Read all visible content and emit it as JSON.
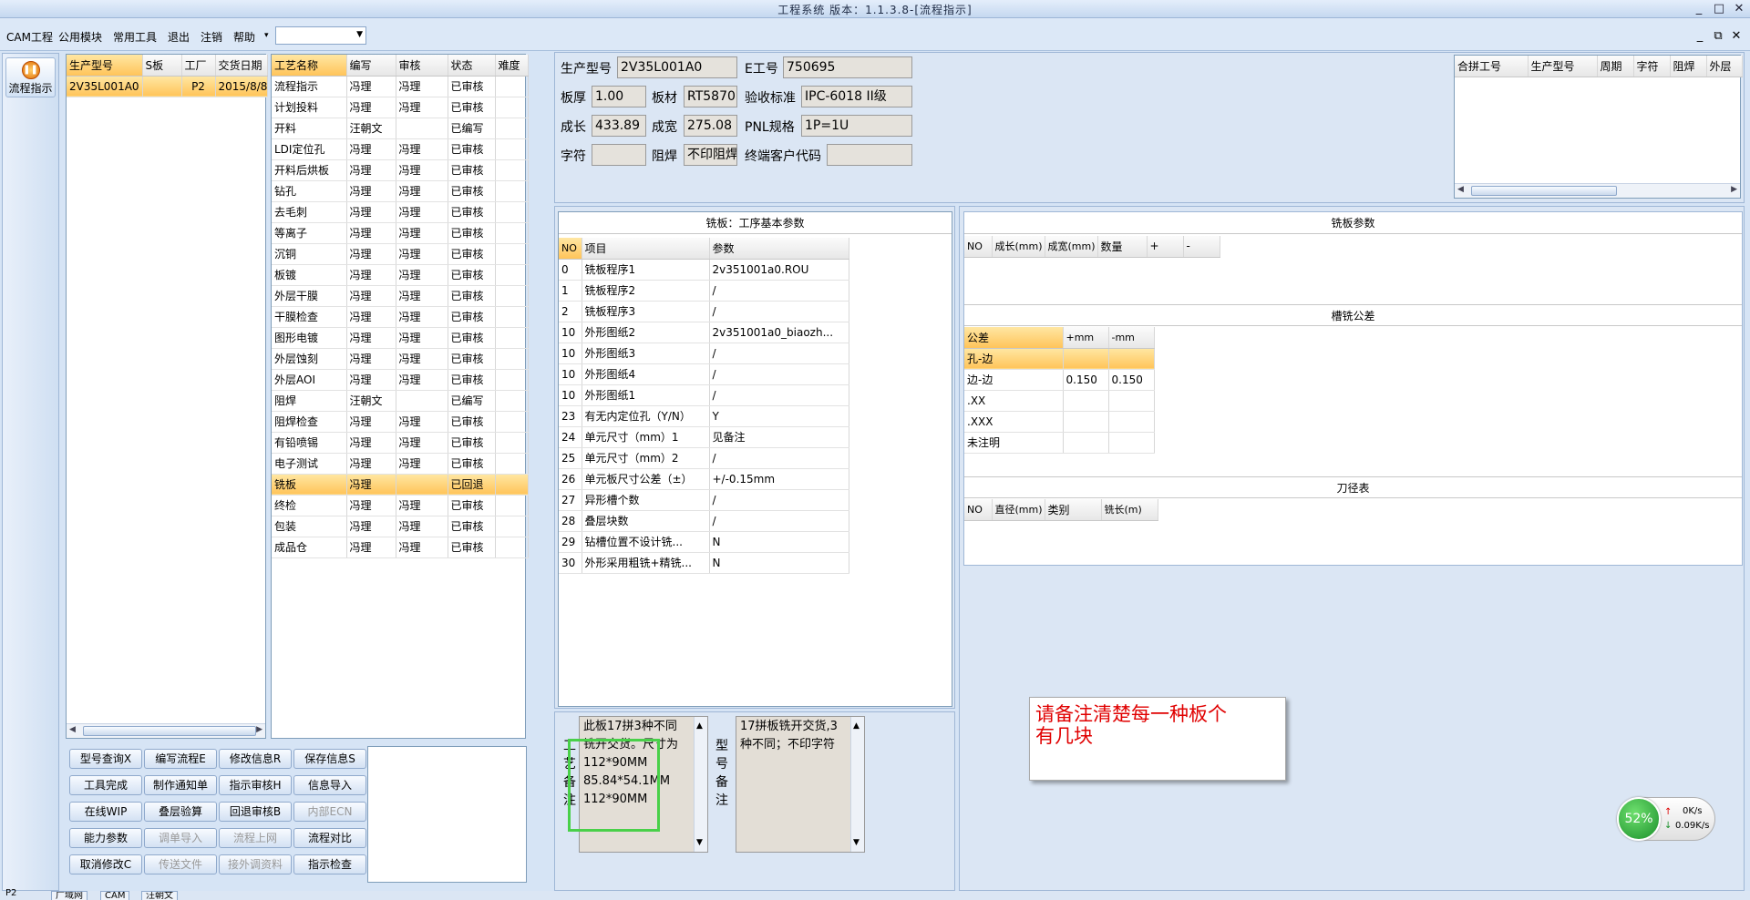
{
  "window": {
    "title": "工程系统 版本：1.1.3.8-[流程指示]",
    "controls": [
      "_",
      "□",
      "✕"
    ]
  },
  "menubar": {
    "items": [
      "CAM工程",
      "公用模块",
      "常用工具",
      "退出",
      "注销",
      "帮助"
    ],
    "mdi_controls": [
      "_",
      "⧉",
      "✕"
    ]
  },
  "leftnav": {
    "label": "流程指示"
  },
  "part_list": {
    "headers": [
      "生产型号",
      "S板",
      "工厂",
      "交货日期"
    ],
    "rows": [
      [
        "2V35L001A0",
        "",
        "P2",
        "2015/8/8"
      ]
    ]
  },
  "process_list": {
    "headers": [
      "工艺名称",
      "编写",
      "审核",
      "状态",
      "难度"
    ],
    "selected_index": 19,
    "rows": [
      [
        "流程指示",
        "冯理",
        "冯理",
        "已审核",
        ""
      ],
      [
        "计划投料",
        "冯理",
        "冯理",
        "已审核",
        ""
      ],
      [
        "开料",
        "汪朝文",
        "",
        "已编写",
        ""
      ],
      [
        "LDI定位孔",
        "冯理",
        "冯理",
        "已审核",
        ""
      ],
      [
        "开料后烘板",
        "冯理",
        "冯理",
        "已审核",
        ""
      ],
      [
        "钻孔",
        "冯理",
        "冯理",
        "已审核",
        ""
      ],
      [
        "去毛刺",
        "冯理",
        "冯理",
        "已审核",
        ""
      ],
      [
        "等离子",
        "冯理",
        "冯理",
        "已审核",
        ""
      ],
      [
        "沉铜",
        "冯理",
        "冯理",
        "已审核",
        ""
      ],
      [
        "板镀",
        "冯理",
        "冯理",
        "已审核",
        ""
      ],
      [
        "外层干膜",
        "冯理",
        "冯理",
        "已审核",
        ""
      ],
      [
        "干膜检查",
        "冯理",
        "冯理",
        "已审核",
        ""
      ],
      [
        "图形电镀",
        "冯理",
        "冯理",
        "已审核",
        ""
      ],
      [
        "外层蚀刻",
        "冯理",
        "冯理",
        "已审核",
        ""
      ],
      [
        "外层AOI",
        "冯理",
        "冯理",
        "已审核",
        ""
      ],
      [
        "阻焊",
        "汪朝文",
        "",
        "已编写",
        ""
      ],
      [
        "阻焊检查",
        "冯理",
        "冯理",
        "已审核",
        ""
      ],
      [
        "有铅喷锡",
        "冯理",
        "冯理",
        "已审核",
        ""
      ],
      [
        "电子测试",
        "冯理",
        "冯理",
        "已审核",
        ""
      ],
      [
        "铣板",
        "冯理",
        "",
        "已回退",
        ""
      ],
      [
        "终检",
        "冯理",
        "冯理",
        "已审核",
        ""
      ],
      [
        "包装",
        "冯理",
        "冯理",
        "已审核",
        ""
      ],
      [
        "成品仓",
        "冯理",
        "冯理",
        "已审核",
        ""
      ]
    ]
  },
  "buttons": [
    {
      "label": "型号查询X",
      "enabled": true
    },
    {
      "label": "编写流程E",
      "enabled": true
    },
    {
      "label": "修改信息R",
      "enabled": true
    },
    {
      "label": "保存信息S",
      "enabled": true
    },
    {
      "label": "工具完成",
      "enabled": true
    },
    {
      "label": "制作通知单",
      "enabled": true
    },
    {
      "label": "指示审核H",
      "enabled": true
    },
    {
      "label": "信息导入",
      "enabled": true
    },
    {
      "label": "在线WIP",
      "enabled": true
    },
    {
      "label": "叠层验算",
      "enabled": true
    },
    {
      "label": "回退审核B",
      "enabled": true
    },
    {
      "label": "内部ECN",
      "enabled": false
    },
    {
      "label": "能力参数",
      "enabled": true
    },
    {
      "label": "调单导入",
      "enabled": false
    },
    {
      "label": "流程上网",
      "enabled": false
    },
    {
      "label": "流程对比",
      "enabled": true
    },
    {
      "label": "取消修改C",
      "enabled": true
    },
    {
      "label": "传送文件",
      "enabled": false
    },
    {
      "label": "接外调资料",
      "enabled": false
    },
    {
      "label": "指示检查",
      "enabled": true
    }
  ],
  "info": {
    "prod_model": {
      "label": "生产型号",
      "value": "2V35L001A0"
    },
    "e_no": {
      "label": "E工号",
      "value": "750695"
    },
    "thickness": {
      "label": "板厚",
      "value": "1.00"
    },
    "material": {
      "label": "板材",
      "value": "RT5870"
    },
    "standard": {
      "label": "验收标准",
      "value": "IPC-6018 II级"
    },
    "length": {
      "label": "成长",
      "value": "433.89"
    },
    "width": {
      "label": "成宽",
      "value": "275.08"
    },
    "pnl": {
      "label": "PNL规格",
      "value": "1P=1U"
    },
    "text": {
      "label": "字符",
      "value": ""
    },
    "mask": {
      "label": "阻焊",
      "value": "不印阻焊"
    },
    "customer": {
      "label": "终端客户代码",
      "value": ""
    }
  },
  "merge_table": {
    "headers": [
      "合拼工号",
      "生产型号",
      "周期",
      "字符",
      "阻焊",
      "外层"
    ]
  },
  "milling_params": {
    "title": "铣板：工序基本参数",
    "headers": [
      "NO",
      "项目",
      "参数"
    ],
    "rows": [
      [
        "0",
        "铣板程序1",
        "2v351001a0.ROU"
      ],
      [
        "1",
        "铣板程序2",
        "/"
      ],
      [
        "2",
        "铣板程序3",
        "/"
      ],
      [
        "10",
        "外形图纸2",
        "2v351001a0_biaozh..."
      ],
      [
        "10",
        "外形图纸3",
        "/"
      ],
      [
        "10",
        "外形图纸4",
        "/"
      ],
      [
        "10",
        "外形图纸1",
        "/"
      ],
      [
        "23",
        "有无内定位孔（Y/N）",
        "Y"
      ],
      [
        "24",
        "单元尺寸（mm）1",
        "见备注"
      ],
      [
        "25",
        "单元尺寸（mm）2",
        "/"
      ],
      [
        "26",
        "单元板尺寸公差（±）",
        "+/-0.15mm"
      ],
      [
        "27",
        "异形槽个数",
        "/"
      ],
      [
        "28",
        "叠层块数",
        "/"
      ],
      [
        "29",
        "钻槽位置不设计铣...",
        "N"
      ],
      [
        "30",
        "外形采用粗铣+精铣...",
        "N"
      ]
    ]
  },
  "panel_params": {
    "title": "铣板参数",
    "headers": [
      "NO",
      "成长(mm)",
      "成宽(mm)",
      "数量",
      "+",
      "-"
    ]
  },
  "slot_tolerance": {
    "title": "槽铣公差",
    "headers": [
      "公差",
      "+mm",
      "-mm"
    ],
    "rows": [
      [
        "孔-边",
        "",
        ""
      ],
      [
        "边-边",
        "0.150",
        "0.150"
      ],
      [
        ".XX",
        "",
        ""
      ],
      [
        ".XXX",
        "",
        ""
      ],
      [
        "未注明",
        "",
        ""
      ]
    ]
  },
  "tool_table": {
    "title": "刀径表",
    "headers": [
      "NO",
      "直径(mm)",
      "类别",
      "铣长(m)"
    ]
  },
  "remarks": {
    "craft_label": "工艺备注",
    "craft_lines": [
      "此板17拼3种不同",
      "铣开交货。尺寸为",
      "112*90MM",
      "85.84*54.1MM",
      "112*90MM"
    ],
    "model_label": "型号备注",
    "model_lines": [
      "17拼板铣开交货,3",
      "种不同；不印字符"
    ]
  },
  "annotation": {
    "line1": "请备注清楚每一种板个",
    "line2": "有几块",
    "color": "#e00000"
  },
  "netmon": {
    "percent": "52%",
    "up": "0K/s",
    "down": "0.09K/s"
  },
  "taskbar": {
    "items": [
      "P2",
      "广域网",
      "CAM",
      "汪朝文"
    ]
  }
}
